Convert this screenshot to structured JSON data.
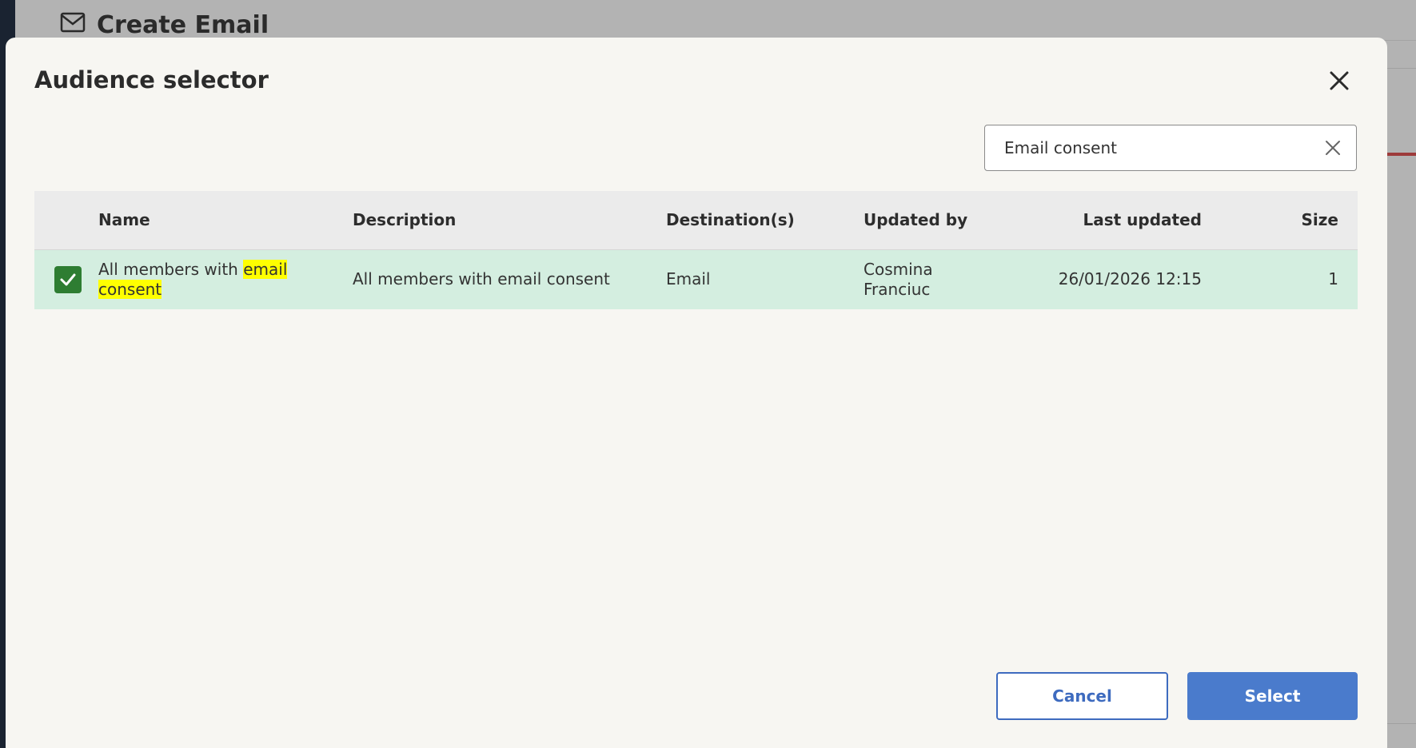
{
  "background": {
    "page_title": "Create Email",
    "page_icon": "mail-icon"
  },
  "modal": {
    "title": "Audience selector",
    "close_icon": "close-icon"
  },
  "search": {
    "value": "Email consent",
    "clear_icon": "clear-icon"
  },
  "table": {
    "columns": [
      "Name",
      "Description",
      "Destination(s)",
      "Updated by",
      "Last updated",
      "Size"
    ],
    "rows": [
      {
        "checked": true,
        "name_prefix": "All members with ",
        "name_match_1": "email",
        "name_match_2": "consent",
        "description": "All members with email consent",
        "destinations": "Email",
        "updated_by_line1": "Cosmina",
        "updated_by_line2": "Franciuc",
        "last_updated": "26/01/2026 12:15",
        "size": "1"
      }
    ]
  },
  "footer": {
    "cancel_label": "Cancel",
    "select_label": "Select"
  },
  "colors": {
    "selected_row": "#d4eee0",
    "checkbox": "#2e7d32",
    "primary": "#4a7bcc",
    "highlight": "#ffff00"
  }
}
